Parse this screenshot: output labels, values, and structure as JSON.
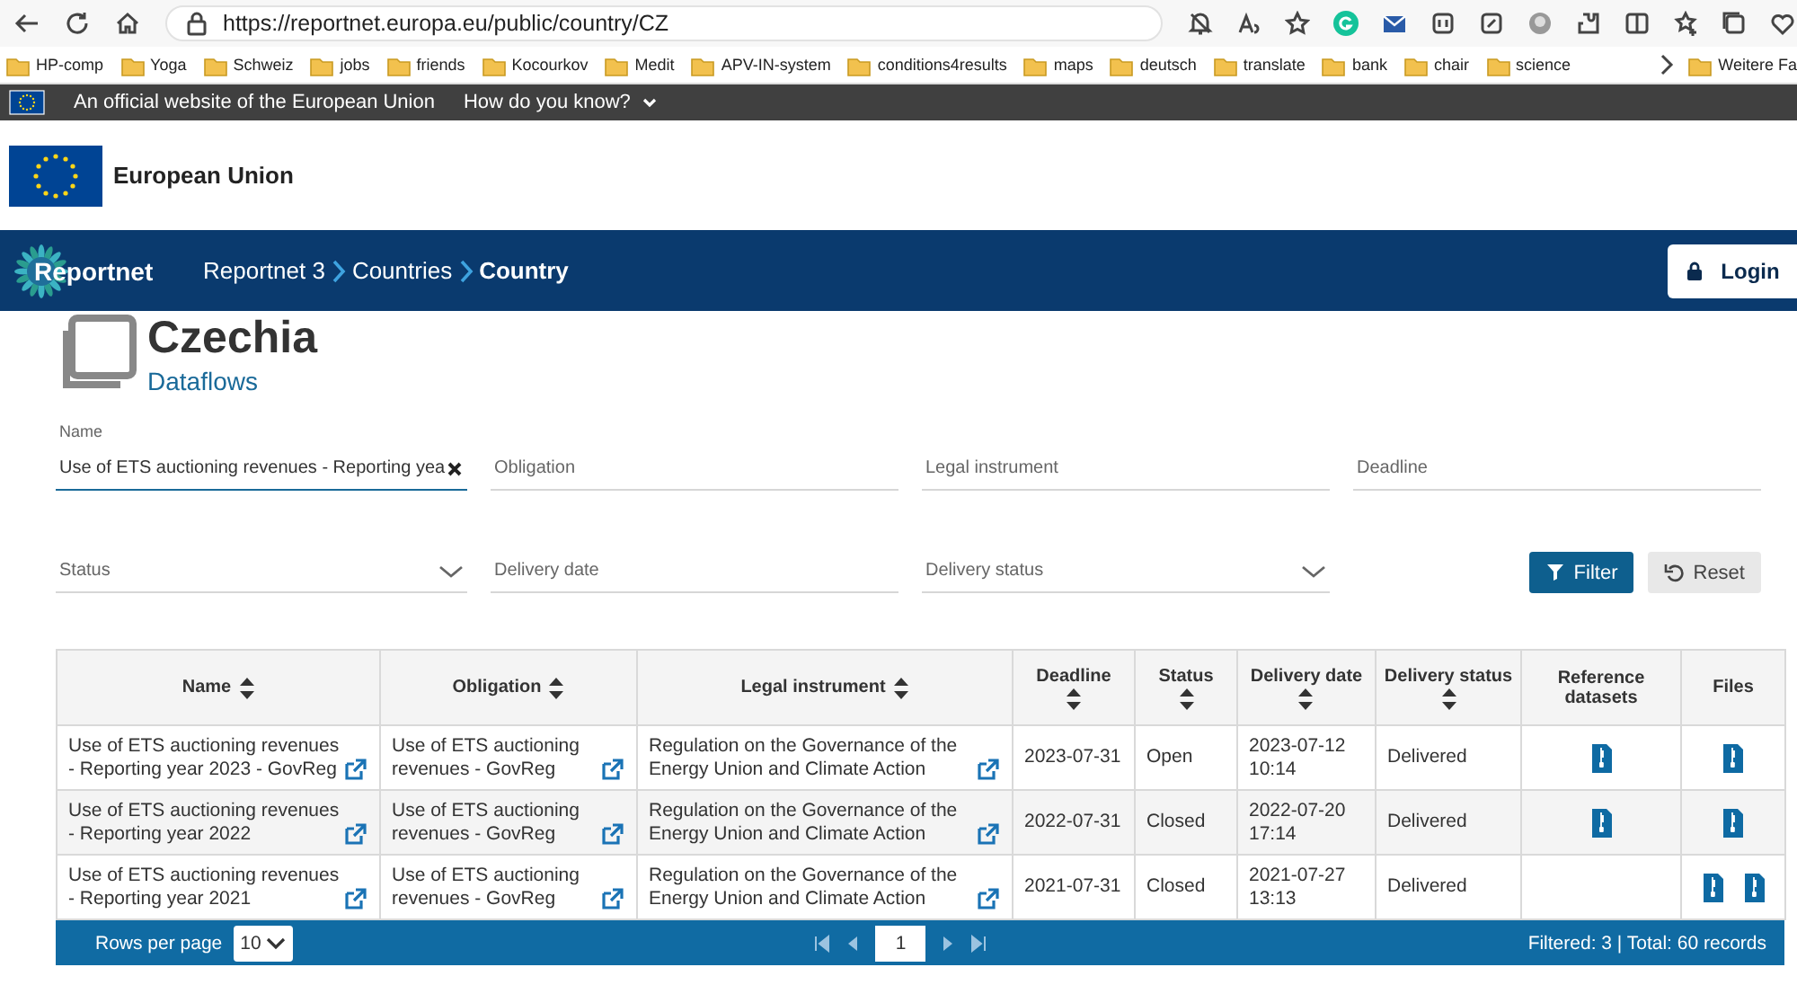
{
  "browser": {
    "url": "https://reportnet.europa.eu/public/country/CZ",
    "bookmarks": [
      "HP-comp",
      "Yoga",
      "Schweiz",
      "jobs",
      "friends",
      "Kocourkov",
      "Medit",
      "APV-IN-system",
      "conditions4results",
      "maps",
      "deutsch",
      "translate",
      "bank",
      "chair",
      "science"
    ],
    "more_bookmarks": "Weitere Fa"
  },
  "eu_banner": {
    "text": "An official website of the European Union",
    "link": "How do you know?"
  },
  "eu_header": {
    "title": "European Union"
  },
  "nav": {
    "brand": "Reportnet",
    "breadcrumbs": [
      {
        "label": "Reportnet 3",
        "current": false
      },
      {
        "label": "Countries",
        "current": false
      },
      {
        "label": "Country",
        "current": true
      }
    ],
    "login": "Login"
  },
  "heading": {
    "title": "Czechia",
    "subtitle": "Dataflows"
  },
  "filters": [
    {
      "kind": "text",
      "label": "Name",
      "value": "Use of ETS auctioning revenues - Reporting yea"
    },
    {
      "kind": "text",
      "placeholder": "Obligation"
    },
    {
      "kind": "text",
      "placeholder": "Legal instrument"
    },
    {
      "kind": "text",
      "placeholder": "Deadline"
    },
    {
      "kind": "dropdown",
      "placeholder": "Status"
    },
    {
      "kind": "text",
      "placeholder": "Delivery date"
    },
    {
      "kind": "dropdown",
      "placeholder": "Delivery status"
    }
  ],
  "filter_buttons": [
    {
      "kind": "primary",
      "label": "Filter"
    },
    {
      "kind": "secondary",
      "label": "Reset"
    }
  ],
  "table": {
    "columns": [
      {
        "label": "Name",
        "sortable": true
      },
      {
        "label": "Obligation",
        "sortable": true
      },
      {
        "label": "Legal instrument",
        "sortable": true
      },
      {
        "label": "Deadline",
        "sortable": true
      },
      {
        "label": "Status",
        "sortable": true
      },
      {
        "label": "Delivery date",
        "sortable": true
      },
      {
        "label": "Delivery status",
        "sortable": true
      },
      {
        "label": "Reference datasets",
        "sortable": false
      },
      {
        "label": "Files",
        "sortable": false
      }
    ],
    "rows": [
      {
        "name": "Use of ETS auctioning revenues - Reporting year 2023 - GovReg",
        "obligation": "Use of ETS auctioning revenues - GovReg",
        "legal_instrument": "Regulation on the Governance of the Energy Union and Climate Action",
        "deadline": "2023-07-31",
        "status": "Open",
        "delivery_date": "2023-07-12 10:14",
        "delivery_status": "Delivered",
        "reference_dataset": true,
        "files": [
          {
            "kind": "zip"
          }
        ]
      },
      {
        "name": "Use of ETS auctioning revenues - Reporting year 2022",
        "obligation": "Use of ETS auctioning revenues - GovReg",
        "legal_instrument": "Regulation on the Governance of the Energy Union and Climate Action",
        "deadline": "2022-07-31",
        "status": "Closed",
        "delivery_date": "2022-07-20 17:14",
        "delivery_status": "Delivered",
        "reference_dataset": true,
        "files": [
          {
            "kind": "zip"
          }
        ]
      },
      {
        "name": "Use of ETS auctioning revenues - Reporting year 2021",
        "obligation": "Use of ETS auctioning revenues - GovReg",
        "legal_instrument": "Regulation on the Governance of the Energy Union and Climate Action",
        "deadline": "2021-07-31",
        "status": "Closed",
        "delivery_date": "2021-07-27 13:13",
        "delivery_status": "Delivered",
        "reference_dataset": false,
        "files": [
          {
            "kind": "zip"
          },
          {
            "kind": "zip"
          }
        ]
      }
    ]
  },
  "pager": {
    "rows_per_page_label": "Rows per page",
    "rows_per_page": "10",
    "page": "1",
    "summary": "Filtered: 3 | Total: 60 records"
  }
}
